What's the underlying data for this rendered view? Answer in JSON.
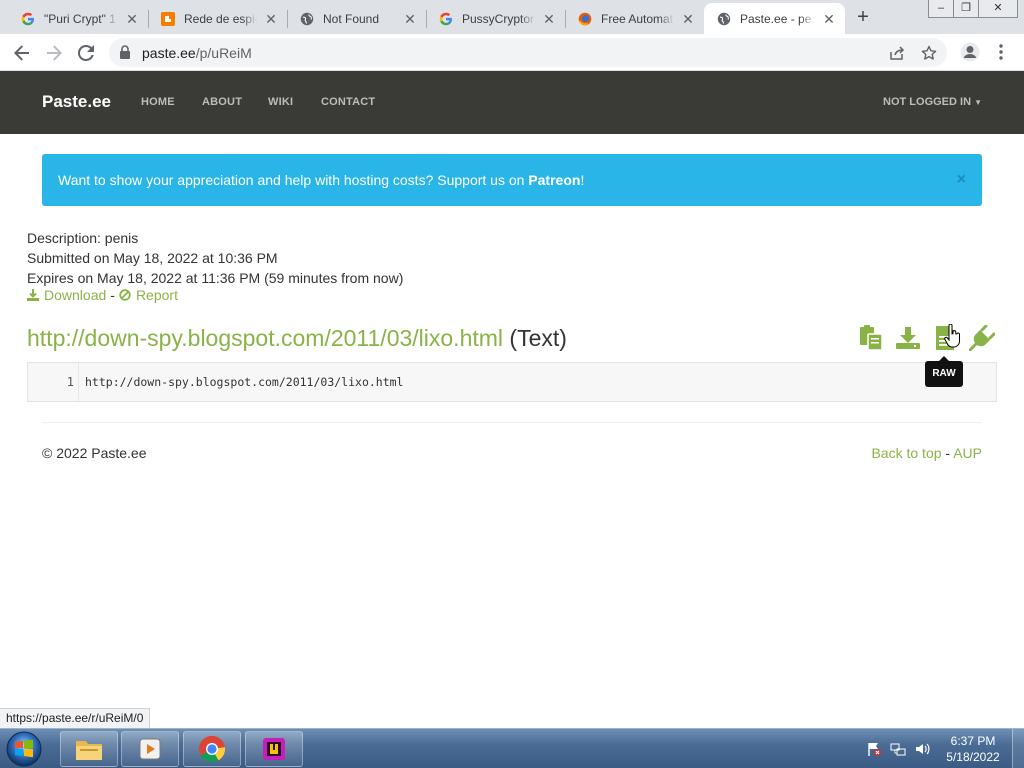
{
  "browser": {
    "tabs": [
      {
        "title": "\"Puri Crypt\" 1",
        "icon": "google-icon"
      },
      {
        "title": "Rede de espio",
        "icon": "blogger-icon"
      },
      {
        "title": "Not Found",
        "icon": "globe-icon"
      },
      {
        "title": "PussyCryptor",
        "icon": "google-icon"
      },
      {
        "title": "Free Automat",
        "icon": "firefox-icon"
      },
      {
        "title": "Paste.ee - pe",
        "icon": "globe-icon"
      }
    ],
    "url_host": "paste.ee",
    "url_path": "/p/uReiM"
  },
  "site": {
    "brand": "Paste.ee",
    "nav": [
      "HOME",
      "ABOUT",
      "WIKI",
      "CONTACT"
    ],
    "login": "NOT LOGGED IN",
    "alert_text": "Want to show your appreciation and help with hosting costs? Support us on ",
    "alert_link": "Patreon",
    "alert_end": "!",
    "alert_close": "×"
  },
  "paste": {
    "description": "Description: penis",
    "submitted": "Submitted on May 18, 2022 at 10:36 PM",
    "expires": "Expires on May 18, 2022 at 11:36 PM (59 minutes from now)",
    "download_label": "Download",
    "separator": "-",
    "report_label": "Report",
    "title_link": "http://down-spy.blogspot.com/2011/03/lixo.html",
    "title_type": "(Text)",
    "line_number": "1",
    "line_content": "http://down-spy.blogspot.com/2011/03/lixo.html",
    "tooltip": "RAW"
  },
  "footer": {
    "copyright": "© 2022 Paste.ee",
    "back_to_top": "Back to top",
    "separator": "-",
    "aup": "AUP"
  },
  "status_url": "https://paste.ee/r/uReiM/0",
  "taskbar": {
    "time": "6:37 PM",
    "date": "5/18/2022"
  },
  "colors": {
    "accent": "#8ab347",
    "navbar": "#3a3a36",
    "alert": "#29b5e8"
  }
}
